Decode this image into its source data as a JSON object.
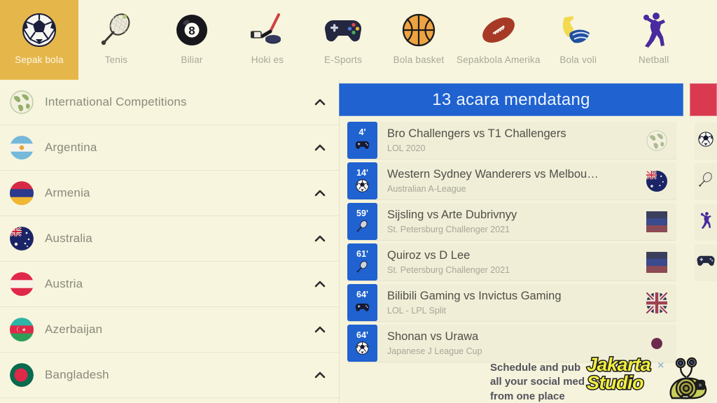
{
  "sports_nav": {
    "tabs": [
      {
        "label": "Sepak bola",
        "icon": "soccer-ball-icon",
        "active": true
      },
      {
        "label": "Tenis",
        "icon": "tennis-racket-icon",
        "active": false
      },
      {
        "label": "Biliar",
        "icon": "billiard-8ball-icon",
        "active": false
      },
      {
        "label": "Hoki es",
        "icon": "ice-hockey-icon",
        "active": false
      },
      {
        "label": "E-Sports",
        "icon": "gamepad-icon",
        "active": false
      },
      {
        "label": "Bola basket",
        "icon": "basketball-icon",
        "active": false
      },
      {
        "label": "Sepakbola Amerika",
        "icon": "american-football-icon",
        "active": false
      },
      {
        "label": "Bola voli",
        "icon": "volleyball-icon",
        "active": false
      },
      {
        "label": "Netball",
        "icon": "netball-player-icon",
        "active": false
      }
    ],
    "active_bg_color": "#e5b64a",
    "bg_color": "#f7f5dd"
  },
  "sidebar": {
    "items": [
      {
        "label": "International Competitions",
        "flag": "globe-icon",
        "chevron": "chevron-up-icon"
      },
      {
        "label": "Argentina",
        "flag": "flag-argentina",
        "chevron": "chevron-up-icon"
      },
      {
        "label": "Armenia",
        "flag": "flag-armenia",
        "chevron": "chevron-up-icon"
      },
      {
        "label": "Australia",
        "flag": "flag-australia",
        "chevron": "chevron-up-icon"
      },
      {
        "label": "Austria",
        "flag": "flag-austria",
        "chevron": "chevron-up-icon"
      },
      {
        "label": "Azerbaijan",
        "flag": "flag-azerbaijan",
        "chevron": "chevron-up-icon"
      },
      {
        "label": "Bangladesh",
        "flag": "flag-bangladesh",
        "chevron": "chevron-up-icon"
      }
    ]
  },
  "events_panel": {
    "header_title": "13 acara mendatang",
    "header_color": "#1f62d0",
    "events": [
      {
        "time": "4'",
        "sport_icon": "gamepad-icon",
        "title": "Bro Challengers vs T1 Challengers",
        "league": "LOL 2020",
        "flag": "globe-icon"
      },
      {
        "time": "14'",
        "sport_icon": "soccer-ball-icon",
        "title": "Western Sydney Wanderers vs Melbou…",
        "league": "Australian A-League",
        "flag": "flag-australia"
      },
      {
        "time": "59'",
        "sport_icon": "tennis-racket-icon",
        "title": "Sijsling vs Arte Dubrivnyy",
        "league": "St. Petersburg Challenger 2021",
        "flag": "flag-russia"
      },
      {
        "time": "61'",
        "sport_icon": "tennis-racket-icon",
        "title": "Quiroz vs D Lee",
        "league": "St. Petersburg Challenger 2021",
        "flag": "flag-russia"
      },
      {
        "time": "64'",
        "sport_icon": "gamepad-icon",
        "title": "Bilibili Gaming vs Invictus Gaming",
        "league": "LOL - LPL Split",
        "flag": "flag-uk"
      },
      {
        "time": "64'",
        "sport_icon": "soccer-ball-icon",
        "title": "Shonan vs Urawa",
        "league": "Japanese J League Cup",
        "flag": "flag-japan"
      }
    ]
  },
  "right_rail": {
    "header_color": "#d93a4f",
    "items": [
      {
        "icon": "soccer-ball-icon"
      },
      {
        "icon": "tennis-racket-icon"
      },
      {
        "icon": "netball-player-icon"
      },
      {
        "icon": "gamepad-icon"
      }
    ]
  },
  "promo": {
    "line1": "Schedule and pub",
    "line2": "all your social med",
    "line3": "from one place"
  },
  "watermark": {
    "line1": "Jakarta",
    "line2": "Studio",
    "close": "×"
  }
}
